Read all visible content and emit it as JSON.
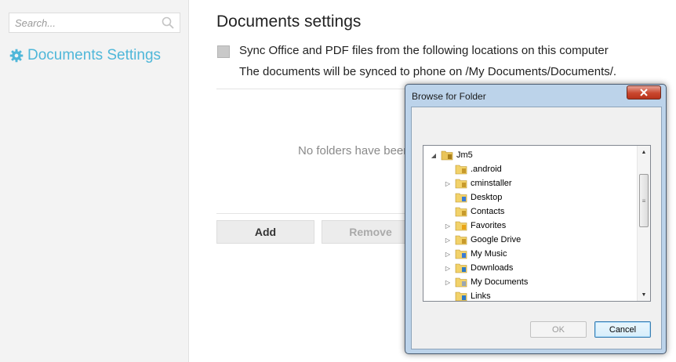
{
  "sidebar": {
    "search_placeholder": "Search...",
    "items": [
      {
        "label": "Documents Settings",
        "icon": "gear-icon",
        "active": true
      }
    ],
    "accent_color": "#4fb7d9"
  },
  "main": {
    "title": "Documents settings",
    "sync_checkbox_label": "Sync Office and PDF files from the following locations on this computer",
    "sync_checked": false,
    "sync_note": "The documents will be synced to phone on /My Documents/Documents/.",
    "empty_text": "No folders have been added",
    "add_button": "Add",
    "remove_button": "Remove"
  },
  "dialog": {
    "title": "Browse for Folder",
    "tree": [
      {
        "label": "Jm5",
        "level": 0,
        "expander": "expanded",
        "icon": "user-folder-icon"
      },
      {
        "label": ".android",
        "level": 1,
        "expander": "none",
        "icon": "folder-icon"
      },
      {
        "label": "cminstaller",
        "level": 1,
        "expander": "collapsed",
        "icon": "folder-icon"
      },
      {
        "label": "Desktop",
        "level": 1,
        "expander": "none",
        "icon": "desktop-folder-icon"
      },
      {
        "label": "Contacts",
        "level": 1,
        "expander": "none",
        "icon": "contacts-folder-icon"
      },
      {
        "label": "Favorites",
        "level": 1,
        "expander": "collapsed",
        "icon": "favorites-folder-icon"
      },
      {
        "label": "Google Drive",
        "level": 1,
        "expander": "collapsed",
        "icon": "folder-icon"
      },
      {
        "label": "My Music",
        "level": 1,
        "expander": "collapsed",
        "icon": "music-folder-icon"
      },
      {
        "label": "Downloads",
        "level": 1,
        "expander": "collapsed",
        "icon": "downloads-folder-icon"
      },
      {
        "label": "My Documents",
        "level": 1,
        "expander": "collapsed",
        "icon": "documents-folder-icon"
      },
      {
        "label": "Links",
        "level": 1,
        "expander": "none",
        "icon": "links-folder-icon"
      }
    ],
    "ok_button": "OK",
    "cancel_button": "Cancel",
    "ok_enabled": false
  }
}
